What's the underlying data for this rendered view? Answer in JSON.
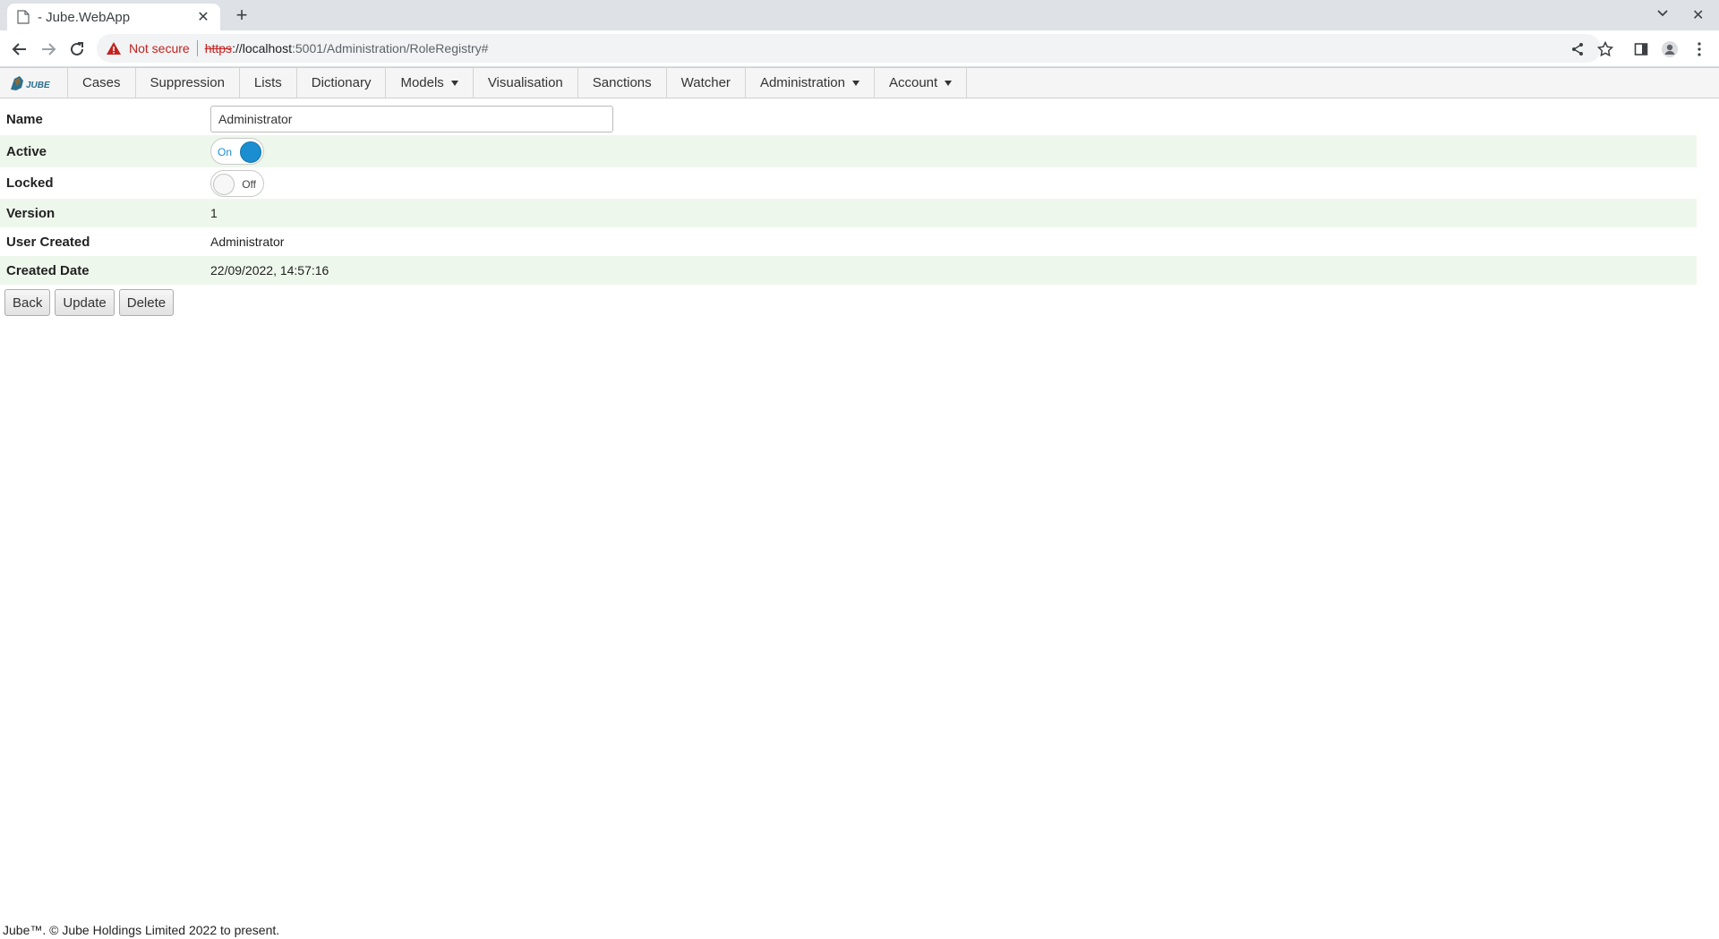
{
  "browser": {
    "tab_title": "- Jube.WebApp",
    "url_warning": "Not secure",
    "url_scheme": "https",
    "url_host": "://localhost",
    "url_path": ":5001/Administration/RoleRegistry#"
  },
  "nav": {
    "brand": "JUBE",
    "items": [
      {
        "label": "Cases",
        "dropdown": false
      },
      {
        "label": "Suppression",
        "dropdown": false
      },
      {
        "label": "Lists",
        "dropdown": false
      },
      {
        "label": "Dictionary",
        "dropdown": false
      },
      {
        "label": "Models",
        "dropdown": true
      },
      {
        "label": "Visualisation",
        "dropdown": false
      },
      {
        "label": "Sanctions",
        "dropdown": false
      },
      {
        "label": "Watcher",
        "dropdown": false
      },
      {
        "label": "Administration",
        "dropdown": true
      },
      {
        "label": "Account",
        "dropdown": true
      }
    ]
  },
  "form": {
    "name_label": "Name",
    "name_value": "Administrator",
    "active_label": "Active",
    "active_state": "On",
    "locked_label": "Locked",
    "locked_state": "Off",
    "version_label": "Version",
    "version_value": "1",
    "user_created_label": "User Created",
    "user_created_value": "Administrator",
    "created_date_label": "Created Date",
    "created_date_value": "22/09/2022, 14:57:16"
  },
  "buttons": {
    "back": "Back",
    "update": "Update",
    "delete": "Delete"
  },
  "footer": {
    "text": "Jube™. © Jube Holdings Limited 2022 to present."
  },
  "colors": {
    "accent": "#1a8ed1",
    "alt_row": "#eef7ec",
    "warning": "#c5221f"
  }
}
